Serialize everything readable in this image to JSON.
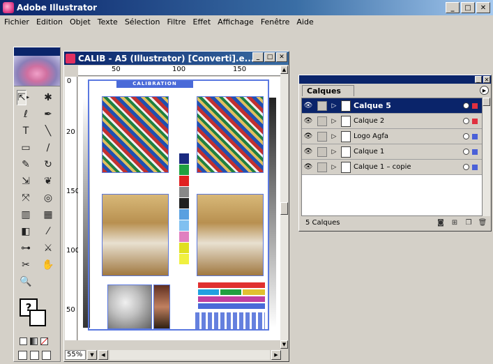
{
  "app": {
    "title": "Adobe Illustrator",
    "brand_color": "#0a246a"
  },
  "menu": [
    "Fichier",
    "Edition",
    "Objet",
    "Texte",
    "Sélection",
    "Filtre",
    "Effet",
    "Affichage",
    "Fenêtre",
    "Aide"
  ],
  "tools": [
    {
      "name": "selection-tool-icon",
      "glyph": "➤"
    },
    {
      "name": "direct-selection-tool-icon",
      "glyph": "⇱"
    },
    {
      "name": "magic-wand-tool-icon",
      "glyph": "✱"
    },
    {
      "name": "lasso-tool-icon",
      "glyph": "ℓ"
    },
    {
      "name": "pen-tool-icon",
      "glyph": "✒"
    },
    {
      "name": "type-tool-icon",
      "glyph": "T"
    },
    {
      "name": "line-tool-icon",
      "glyph": "╲"
    },
    {
      "name": "rectangle-tool-icon",
      "glyph": "▭"
    },
    {
      "name": "paintbrush-tool-icon",
      "glyph": "∕"
    },
    {
      "name": "pencil-tool-icon",
      "glyph": "✎"
    },
    {
      "name": "rotate-tool-icon",
      "glyph": "↻"
    },
    {
      "name": "scale-tool-icon",
      "glyph": "⇲"
    },
    {
      "name": "warp-tool-icon",
      "glyph": "❦"
    },
    {
      "name": "free-transform-tool-icon",
      "glyph": "⤧"
    },
    {
      "name": "symbol-sprayer-tool-icon",
      "glyph": "◎"
    },
    {
      "name": "graph-tool-icon",
      "glyph": "▥"
    },
    {
      "name": "mesh-tool-icon",
      "glyph": "▦"
    },
    {
      "name": "gradient-tool-icon",
      "glyph": "◧"
    },
    {
      "name": "eyedropper-tool-icon",
      "glyph": "⁄"
    },
    {
      "name": "blend-tool-icon",
      "glyph": "⊶"
    },
    {
      "name": "slice-tool-icon",
      "glyph": "⚔"
    },
    {
      "name": "scissors-tool-icon",
      "glyph": "✂"
    },
    {
      "name": "hand-tool-icon",
      "glyph": "✋"
    },
    {
      "name": "zoom-tool-icon",
      "glyph": "🔍"
    }
  ],
  "fill_stroke": {
    "fill_label": "?"
  },
  "document": {
    "title": "CALIB - A5 (Illustrator) [Converti].e...",
    "zoom": "55%",
    "ruler_h": [
      "50",
      "100",
      "150"
    ],
    "ruler_v": [
      "0",
      "20",
      "150",
      "100",
      "50"
    ],
    "art_title": "CALIBRATION"
  },
  "swatch_colors": [
    "#1a2a80",
    "#20a040",
    "#e02020",
    "#888888",
    "#202020",
    "#5aa0e0",
    "#80c0f0",
    "#e080c0",
    "#e0e020",
    "#f0f040"
  ],
  "layers": {
    "tab": "Calques",
    "count": "5 Calques",
    "items": [
      {
        "name": "Calque 5",
        "color": "#e03040",
        "active": true
      },
      {
        "name": "Calque 2",
        "color": "#e03040",
        "active": false
      },
      {
        "name": "Logo Agfa",
        "color": "#4a60d8",
        "active": false
      },
      {
        "name": "Calque 1",
        "color": "#4a60d8",
        "active": false
      },
      {
        "name": "Calque 1 – copie",
        "color": "#4a60d8",
        "active": false
      }
    ]
  }
}
